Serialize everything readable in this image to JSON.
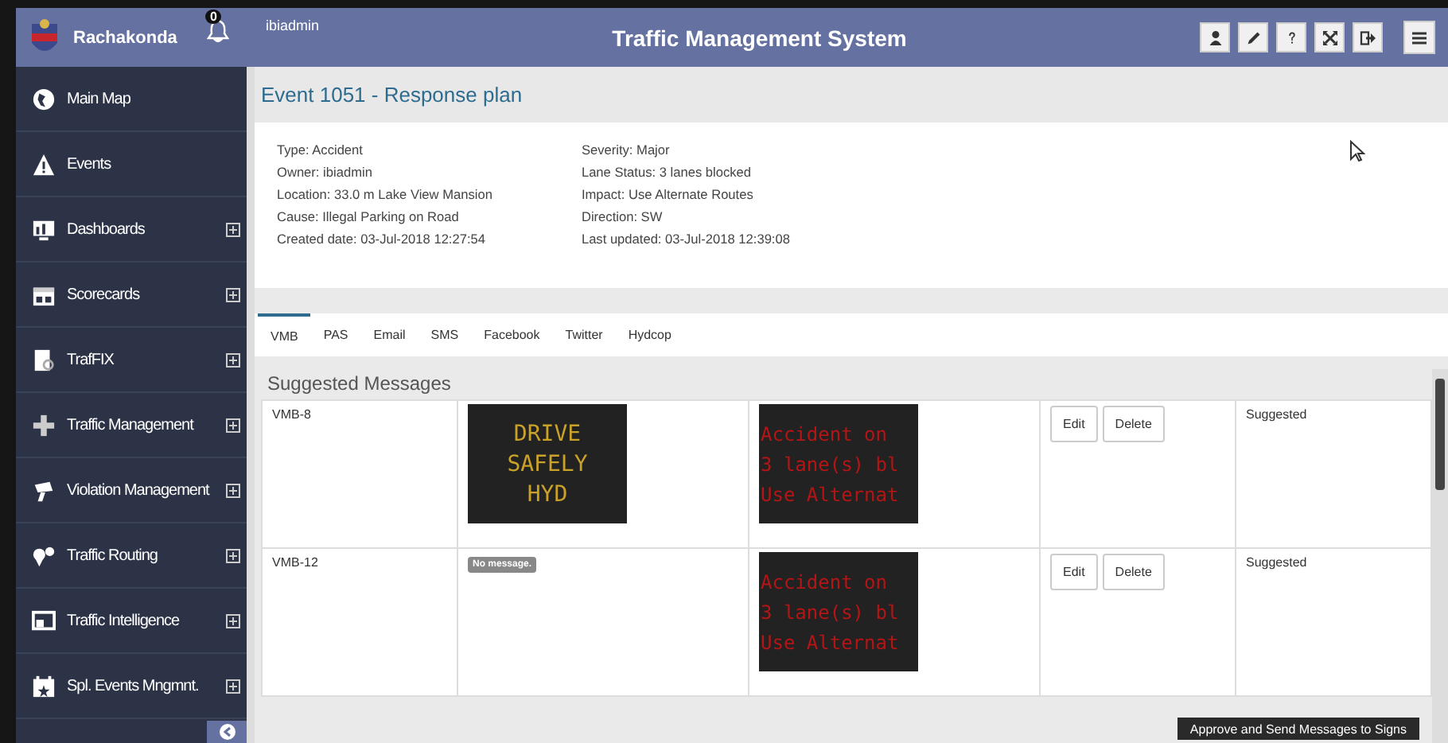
{
  "header": {
    "brand": "Rachakonda",
    "notification_count": "0",
    "user": "ibiadmin",
    "title": "Traffic Management System"
  },
  "sidebar": {
    "items": [
      {
        "label": "Main Map",
        "expandable": false
      },
      {
        "label": "Events",
        "expandable": false
      },
      {
        "label": "Dashboards",
        "expandable": true
      },
      {
        "label": "Scorecards",
        "expandable": true
      },
      {
        "label": "TrafFIX",
        "expandable": true
      },
      {
        "label": "Traffic Management",
        "expandable": true
      },
      {
        "label": "Violation Management",
        "expandable": true
      },
      {
        "label": "Traffic Routing",
        "expandable": true
      },
      {
        "label": "Traffic Intelligence",
        "expandable": true
      },
      {
        "label": "Spl. Events Mngmnt.",
        "expandable": true
      }
    ]
  },
  "event": {
    "title": "Event 1051 - Response plan",
    "details_left": [
      "Type: Accident",
      "Owner: ibiadmin",
      "Location: 33.0 m Lake View Mansion",
      "Cause: Illegal Parking on Road",
      "Created date: 03-Jul-2018 12:27:54"
    ],
    "details_right": [
      "Severity: Major",
      "Lane Status: 3 lanes blocked",
      "Impact: Use Alternate Routes",
      "Direction: SW",
      "Last updated: 03-Jul-2018 12:39:08"
    ]
  },
  "tabs": [
    {
      "label": "VMB",
      "selected": true
    },
    {
      "label": "PAS",
      "selected": false
    },
    {
      "label": "Email",
      "selected": false
    },
    {
      "label": "SMS",
      "selected": false
    },
    {
      "label": "Facebook",
      "selected": false
    },
    {
      "label": "Twitter",
      "selected": false
    },
    {
      "label": "Hydcop",
      "selected": false
    }
  ],
  "suggested_messages": {
    "heading": "Suggested Messages",
    "rows": [
      {
        "sign": "VMB-8",
        "current": {
          "kind": "amber",
          "lines": [
            "DRIVE",
            "SAFELY",
            "HYD"
          ]
        },
        "suggested": {
          "kind": "red",
          "lines": [
            "Accident on",
            "3 lane(s) bl",
            "Use Alternat"
          ]
        },
        "actions": [
          "Edit",
          "Delete"
        ],
        "status": "Suggested"
      },
      {
        "sign": "VMB-12",
        "current": {
          "kind": "empty",
          "text": "No message."
        },
        "suggested": {
          "kind": "red",
          "lines": [
            "Accident on",
            "3 lane(s) bl",
            "Use Alternat"
          ]
        },
        "actions": [
          "Edit",
          "Delete"
        ],
        "status": "Suggested"
      }
    ]
  },
  "footer_button": "Approve and Send Messages to Signs"
}
